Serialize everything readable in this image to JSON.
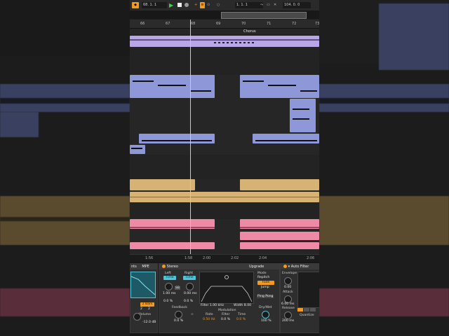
{
  "transport": {
    "bar_position": "68. 1. 1",
    "loop_start": "1. 1. 1",
    "loop_length": "104. 0. 0"
  },
  "ruler": {
    "bars": [
      "66",
      "67",
      "68",
      "69",
      "70",
      "71",
      "72",
      "73"
    ]
  },
  "arrangement": {
    "locator_label": "Chorus"
  },
  "timeline": {
    "labels": [
      "1:56",
      "1:58",
      "2:00",
      "2:02",
      "2:04",
      "2:06"
    ]
  },
  "devices": {
    "left_partial": {
      "label1": "nts",
      "label2": "MPE",
      "rate_value": "2 Bars",
      "volume_label": "Volume",
      "volume_value": "-12.0 dB",
      "num_left": "2",
      "num_right": "2"
    },
    "stereo_delay": {
      "title": "Stereo",
      "upgrade_label": "Upgrade",
      "left_label": "Left",
      "right_label": "Right",
      "left_mode": "Time",
      "right_mode": "Time",
      "left_time": "1.00 ms",
      "right_time": "0.00 ms",
      "left_offset": "0.0 %",
      "right_offset": "0.0 %",
      "link_label": "SB",
      "feedback_label": "Feedback",
      "feedback_value": "0.0 %",
      "filter_text": "Filter 1.00 kHz",
      "width_text": "Width 8.00",
      "modulation_label": "Modulation",
      "rate_label": "Rate",
      "rate_value": "0.50 Hz",
      "filter_mod_label": "Filter",
      "filter_mod_value": "0.0 %",
      "time_mod_label": "Time",
      "time_mod_value": "0.0 %",
      "mode_label": "Mode",
      "mode_repitch": "Repitch",
      "mode_fade": "Fade",
      "mode_jump": "Jump",
      "ping_pong": "Ping Pong",
      "drywet_label": "Dry/Wet",
      "drywet_value": "100 %"
    },
    "auto_filter": {
      "title": "Auto Filter",
      "envelope_label": "Envelope",
      "envelope_value": "0.00",
      "attack_label": "Attack",
      "attack_value": "6.00 ms",
      "release_label": "Release",
      "release_value": "200 ms",
      "quantize_label": "Quantize"
    }
  },
  "colors": {
    "lavender": "#b9a6e6",
    "blue": "#8e98d9",
    "gold": "#d6b374",
    "pink": "#ef8aa6",
    "accent_orange": "#f39a1f",
    "accent_cyan": "#4fc3d9"
  }
}
